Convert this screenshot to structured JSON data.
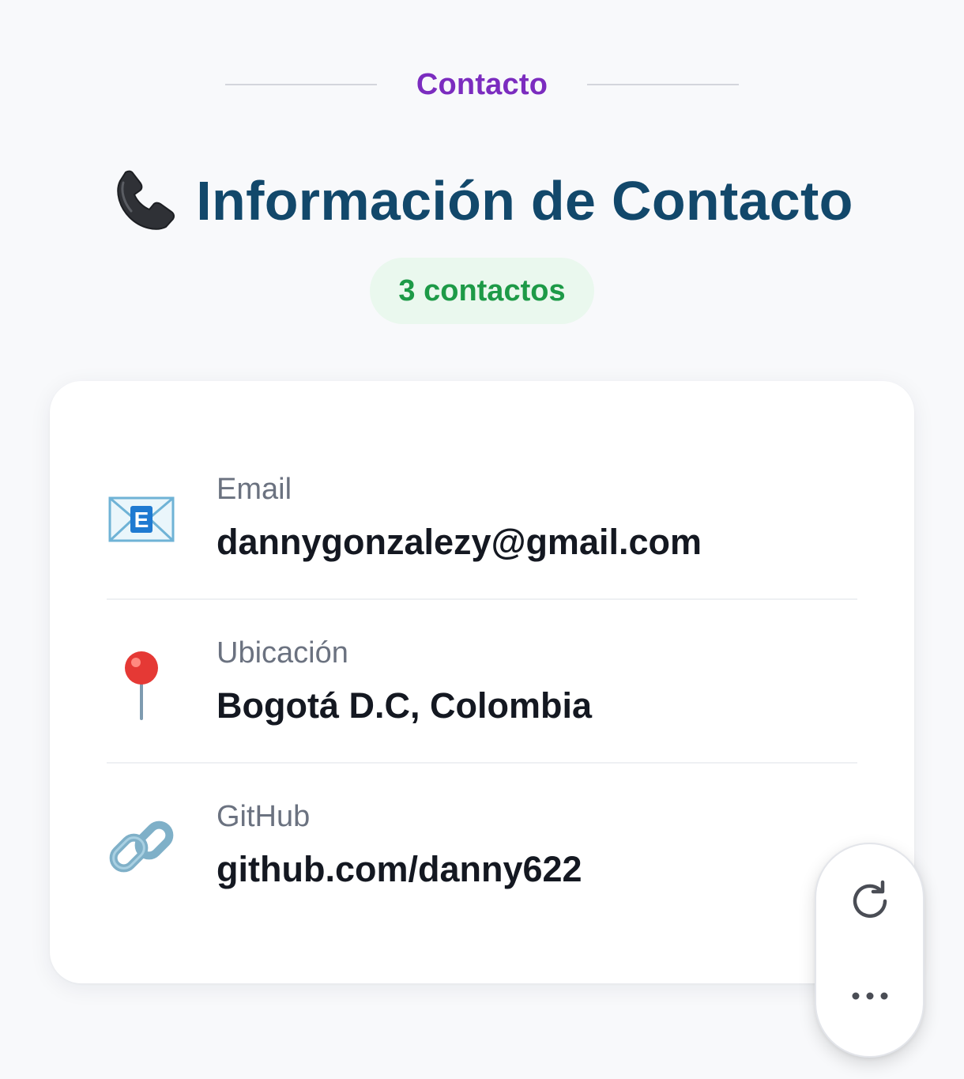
{
  "section": {
    "label": "Contacto"
  },
  "header": {
    "icon": "telephone-receiver-icon",
    "title": "Información de Contacto",
    "count_badge": "3 contactos"
  },
  "contacts": [
    {
      "icon": "email-envelope-icon",
      "label": "Email",
      "value": "dannygonzalezy@gmail.com"
    },
    {
      "icon": "round-pushpin-icon",
      "label": "Ubicación",
      "value": "Bogotá D.C, Colombia"
    },
    {
      "icon": "link-chain-icon",
      "label": "GitHub",
      "value": "github.com/danny622"
    }
  ],
  "floating_actions": [
    {
      "icon": "refresh-icon"
    },
    {
      "icon": "more-horizontal-icon"
    }
  ],
  "colors": {
    "background": "#f8f9fb",
    "section_label": "#7b2cbf",
    "title": "#12486b",
    "badge_bg": "#eaf8ee",
    "badge_text": "#1d9a47",
    "label_text": "#6b7280",
    "value_text": "#141821"
  }
}
